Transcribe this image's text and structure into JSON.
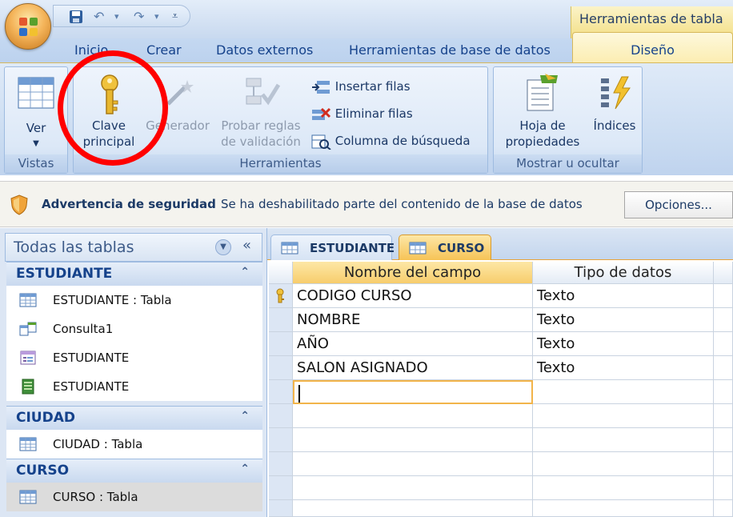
{
  "title_bar": {
    "contextual_tab_title": "Herramientas de tabla"
  },
  "ribbon_tabs": [
    "Inicio",
    "Crear",
    "Datos externos",
    "Herramientas de base de datos",
    "Diseño"
  ],
  "ribbon": {
    "groups": {
      "vistas": {
        "label": "Vistas",
        "ver": "Ver"
      },
      "herramientas": {
        "label": "Herramientas",
        "clave_principal_1": "Clave",
        "clave_principal_2": "principal",
        "generador": "Generador",
        "probar_reglas_1": "Probar reglas",
        "probar_reglas_2": "de validación",
        "insertar_filas": "Insertar filas",
        "eliminar_filas": "Eliminar filas",
        "columna_busqueda": "Columna de búsqueda"
      },
      "mostrar": {
        "label": "Mostrar u ocultar",
        "hoja_1": "Hoja de",
        "hoja_2": "propiedades",
        "indices": "Índices"
      }
    }
  },
  "security_bar": {
    "title": "Advertencia de seguridad",
    "message": "Se ha deshabilitado parte del contenido de la base de datos",
    "options": "Opciones..."
  },
  "nav_pane": {
    "header": "Todas las tablas",
    "groups": [
      {
        "name": "ESTUDIANTE",
        "items": [
          "ESTUDIANTE : Tabla",
          "Consulta1",
          "ESTUDIANTE",
          "ESTUDIANTE"
        ]
      },
      {
        "name": "CIUDAD",
        "items": [
          "CIUDAD : Tabla"
        ]
      },
      {
        "name": "CURSO",
        "items": [
          "CURSO : Tabla"
        ]
      }
    ]
  },
  "document": {
    "tabs": [
      "ESTUDIANTE",
      "CURSO"
    ],
    "columns": [
      "Nombre del campo",
      "Tipo de datos"
    ],
    "rows": [
      [
        "CODIGO CURSO",
        "Texto"
      ],
      [
        "NOMBRE",
        "Texto"
      ],
      [
        "AÑO",
        "Texto"
      ],
      [
        "SALON ASIGNADO",
        "Texto"
      ]
    ]
  }
}
